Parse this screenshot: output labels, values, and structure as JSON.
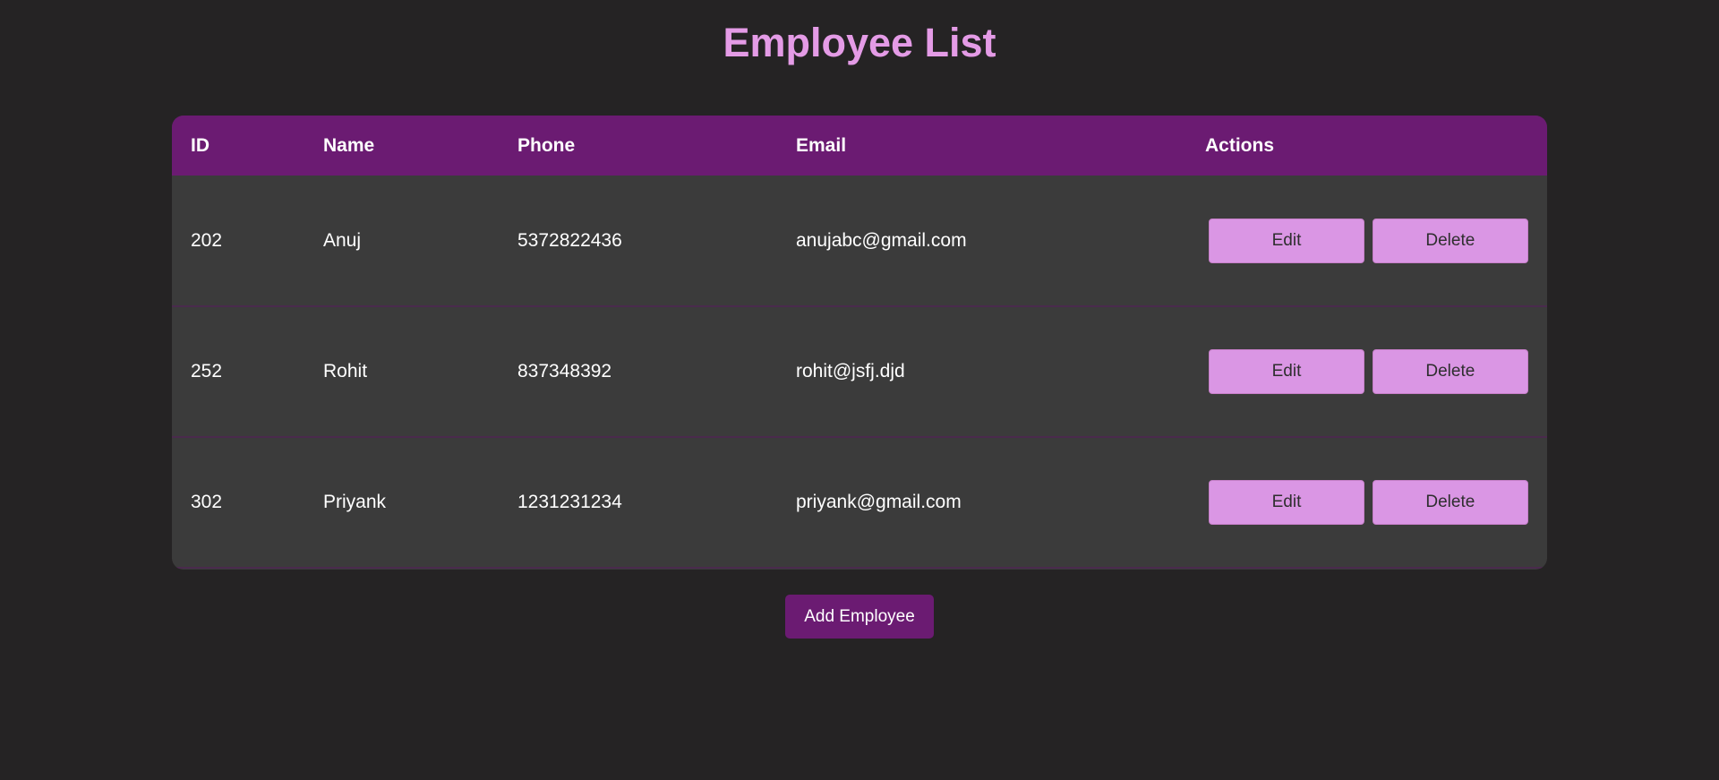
{
  "page": {
    "title": "Employee List"
  },
  "table": {
    "headers": {
      "id": "ID",
      "name": "Name",
      "phone": "Phone",
      "email": "Email",
      "actions": "Actions"
    },
    "rows": [
      {
        "id": "202",
        "name": "Anuj",
        "phone": "5372822436",
        "email": "anujabc@gmail.com",
        "edit_label": "Edit",
        "delete_label": "Delete"
      },
      {
        "id": "252",
        "name": "Rohit",
        "phone": "837348392",
        "email": "rohit@jsfj.djd",
        "edit_label": "Edit",
        "delete_label": "Delete"
      },
      {
        "id": "302",
        "name": "Priyank",
        "phone": "1231231234",
        "email": "priyank@gmail.com",
        "edit_label": "Edit",
        "delete_label": "Delete"
      }
    ]
  },
  "footer": {
    "add_label": "Add Employee"
  },
  "colors": {
    "background": "#252324",
    "title": "#e49be6",
    "header_bg": "#6b1b72",
    "row_bg": "#3b3b3b",
    "action_button": "#da96e4",
    "add_button": "#6b1b72"
  }
}
